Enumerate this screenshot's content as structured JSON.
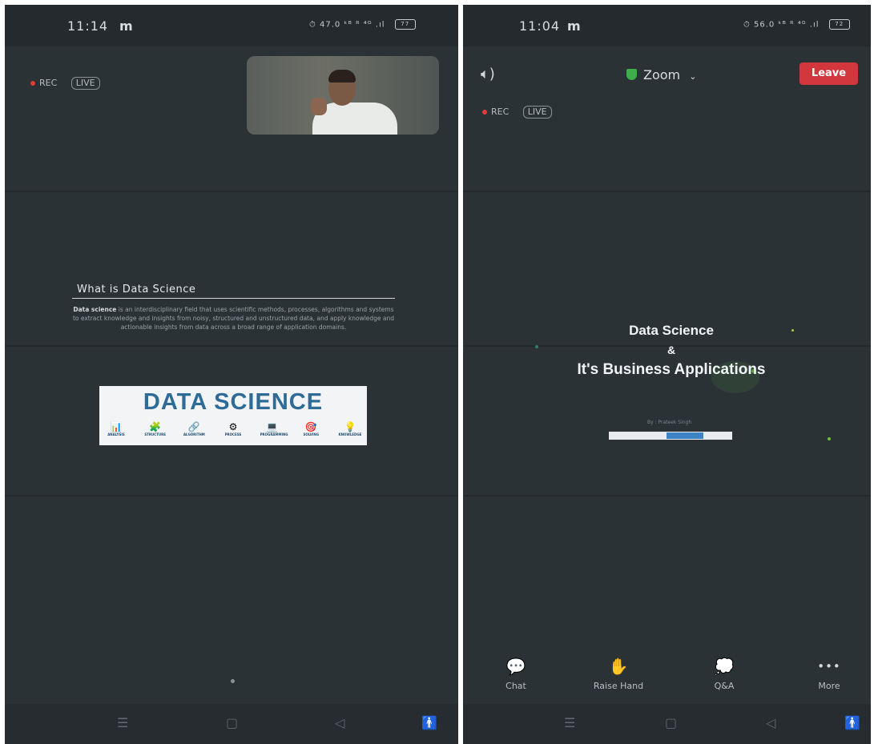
{
  "left_screen": {
    "status": {
      "time": "11:14",
      "carrier_icon": "m",
      "indicators": "⏱ 47.0 ᵏᴮ ᴿ ⁴ᴳ .ıl",
      "battery": "77"
    },
    "rec_label": "REC",
    "live_label": "LIVE",
    "slide": {
      "title": "What is Data Science",
      "body_bold": "Data science",
      "body_rest": " is an interdisciplinary field that uses scientific methods, processes, algorithms and systems to extract knowledge and insights from noisy, structured and unstructured data, and apply knowledge and actionable insights from data across a broad range of application domains.",
      "banner_title": "DATA SCIENCE",
      "banner_items": [
        {
          "icon": "analysis-icon",
          "glyph": "📊",
          "label": "ANALYSIS"
        },
        {
          "icon": "structure-icon",
          "glyph": "🧩",
          "label": "STRUCTURE"
        },
        {
          "icon": "algorithm-icon",
          "glyph": "🔗",
          "label": "ALGORITHM"
        },
        {
          "icon": "process-icon",
          "glyph": "⚙",
          "label": "PROCESS"
        },
        {
          "icon": "programming-icon",
          "glyph": "💻",
          "label": "PROGRAMMING"
        },
        {
          "icon": "solving-icon",
          "glyph": "🎯",
          "label": "SOLVING"
        },
        {
          "icon": "knowledge-icon",
          "glyph": "💡",
          "label": "KNOWLEDGE"
        }
      ]
    }
  },
  "right_screen": {
    "status": {
      "time": "11:04",
      "carrier_icon": "m",
      "indicators": "⏱ 56.0 ᵏᴮ ᴿ ⁴ᴳ .ıl",
      "battery": "72"
    },
    "meeting_label": "Zoom",
    "leave_label": "Leave",
    "rec_label": "REC",
    "live_label": "LIVE",
    "cover": {
      "line1": "Data Science",
      "line2": "&",
      "line3": "It's Business Applications",
      "author": "By : Prateek Singh"
    },
    "toolbar": [
      {
        "name": "chat",
        "glyph": "💬",
        "label": "Chat"
      },
      {
        "name": "raise-hand",
        "glyph": "✋",
        "label": "Raise Hand"
      },
      {
        "name": "qa",
        "glyph": "💭",
        "label": "Q&A"
      },
      {
        "name": "more",
        "glyph": "•••",
        "label": "More"
      }
    ]
  },
  "colors": {
    "background": "#2b3236",
    "leave": "#d2373d",
    "shield": "#3fae4a",
    "banner_title": "#2e6c97"
  }
}
